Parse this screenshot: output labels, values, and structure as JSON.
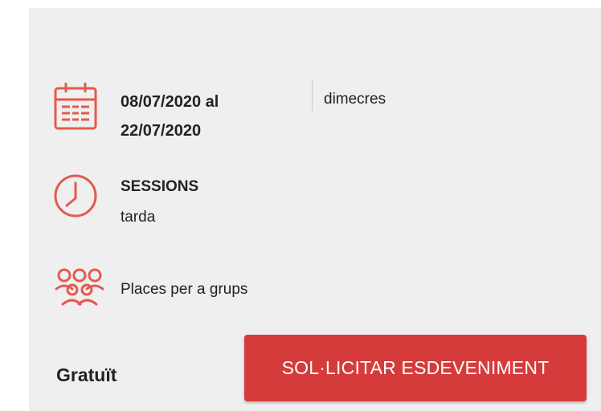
{
  "event": {
    "date_range": "08/07/2020 al 22/07/2020",
    "weekday": "dimecres",
    "sessions_title": "SESSIONS",
    "sessions_value": "tarda",
    "groups_label": "Places per a grups",
    "price": "Gratuït",
    "cta_label": "SOL·LICITAR ESDEVENIMENT"
  },
  "icons": {
    "date": "calendar-icon",
    "sessions": "clock-icon",
    "groups": "group-icon"
  },
  "colors": {
    "accent": "#e55a4e",
    "button": "#d63b3b",
    "background": "#efefef"
  }
}
